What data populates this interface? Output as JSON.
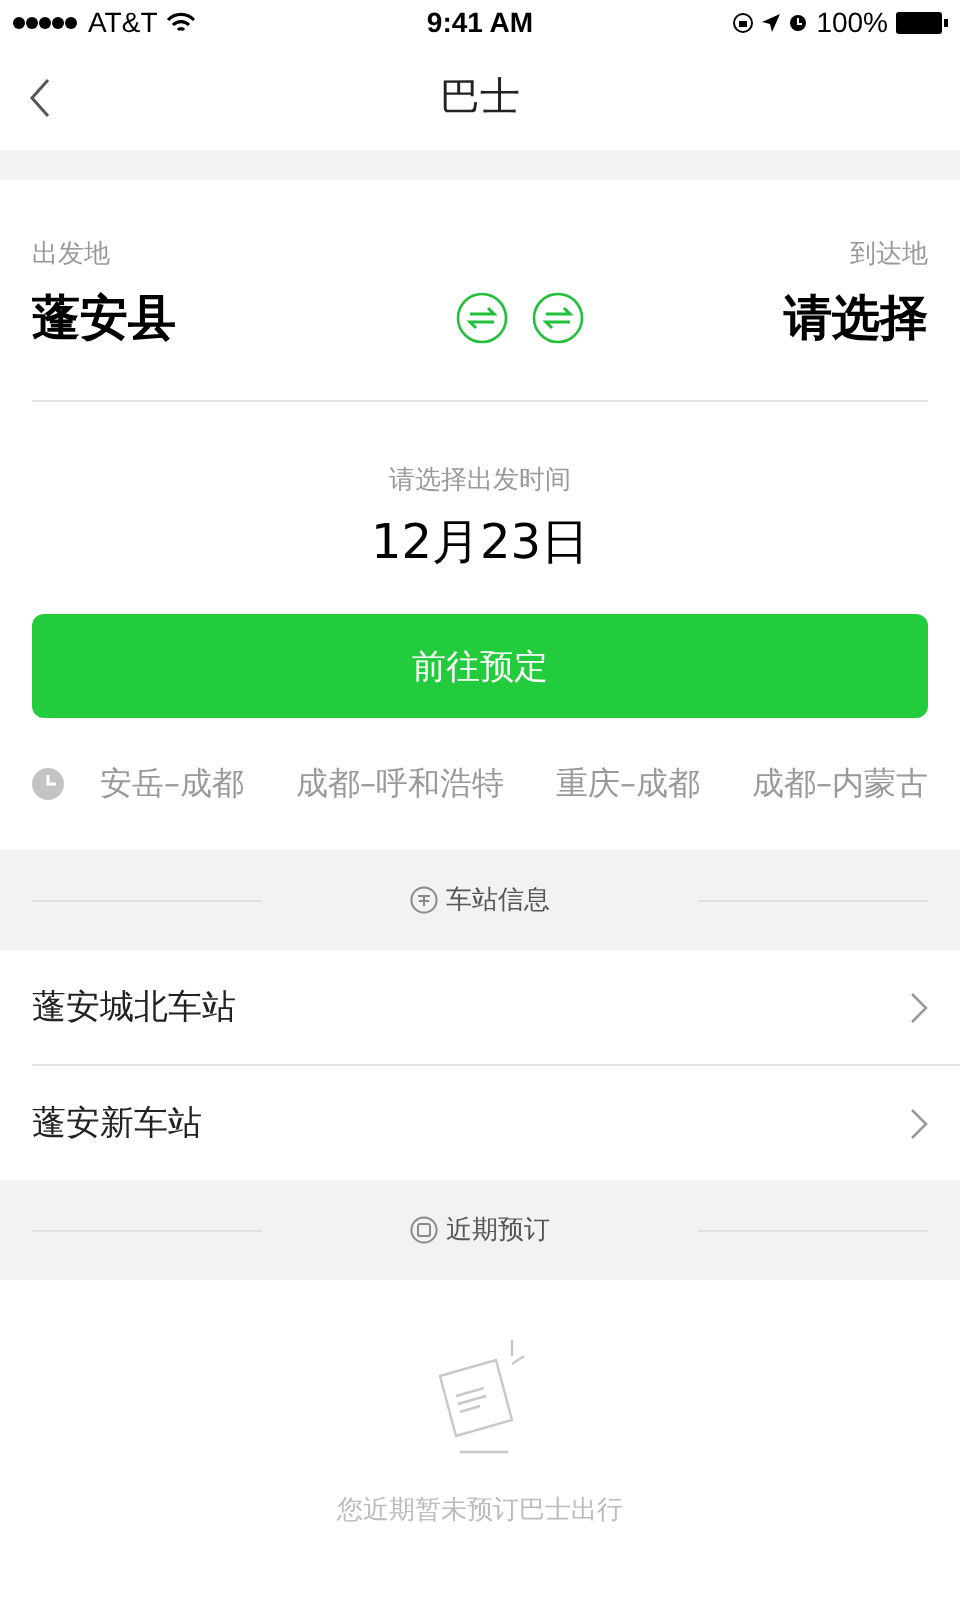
{
  "status_bar": {
    "carrier": "AT&T",
    "time": "9:41 AM",
    "battery": "100%"
  },
  "nav": {
    "title": "巴士"
  },
  "trip": {
    "from_label": "出发地",
    "from": "蓬安县",
    "to_label": "到达地",
    "to": "请选择",
    "time_label": "请选择出发时间",
    "date": "12月23日",
    "button": "前往预定"
  },
  "recent_routes": [
    "安岳–成都",
    "成都–呼和浩特",
    "重庆–成都",
    "成都–内蒙古"
  ],
  "stations": {
    "title": "车站信息",
    "items": [
      "蓬安城北车站",
      "蓬安新车站"
    ]
  },
  "recent_bookings": {
    "title": "近期预订",
    "empty_text": "您近期暂未预订巴士出行"
  }
}
